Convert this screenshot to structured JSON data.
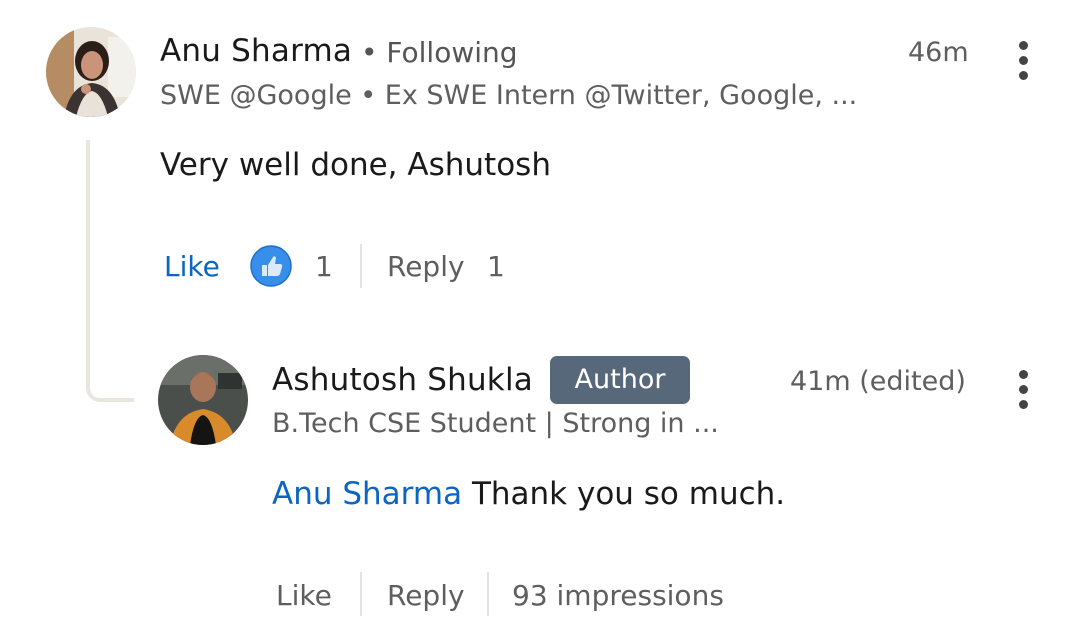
{
  "comment": {
    "author": "Anu Sharma",
    "follow_label": "• Following",
    "headline": "SWE @Google • Ex SWE Intern @Twitter, Google, ...",
    "time": "46m",
    "text": "Very well done, Ashutosh",
    "actions": {
      "like_label": "Like",
      "reaction_icon": "thumbs-up-reaction-icon",
      "reaction_count": "1",
      "reply_label": "Reply",
      "reply_count": "1"
    }
  },
  "reply": {
    "author": "Ashutosh Shukla",
    "badge": "Author",
    "headline": "B.Tech CSE Student | Strong in ...",
    "time": "41m (edited)",
    "mention": "Anu Sharma",
    "text": "Thank you so much.",
    "actions": {
      "like_label": "Like",
      "reply_label": "Reply",
      "impressions": "93 impressions"
    }
  },
  "colors": {
    "link_blue": "#0a66c2",
    "badge_bg": "#56687a",
    "reaction_blue": "#378fe9",
    "thread_line": "#e8e6df"
  }
}
